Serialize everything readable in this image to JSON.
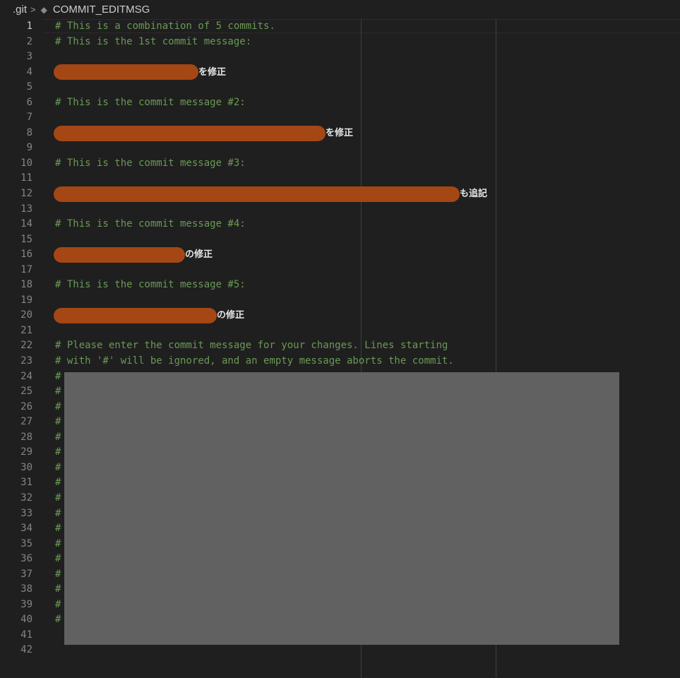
{
  "breadcrumb": {
    "folder": ".git",
    "file": "COMMIT_EDITMSG"
  },
  "active_line": 1,
  "line_numbers": [
    "1",
    "2",
    "3",
    "4",
    "5",
    "6",
    "7",
    "8",
    "9",
    "10",
    "11",
    "12",
    "13",
    "14",
    "15",
    "16",
    "17",
    "18",
    "19",
    "20",
    "21",
    "22",
    "23",
    "24",
    "25",
    "26",
    "27",
    "28",
    "29",
    "30",
    "31",
    "32",
    "33",
    "34",
    "35",
    "36",
    "37",
    "38",
    "39",
    "40",
    "41",
    "42"
  ],
  "lines": [
    "# This is a combination of 5 commits.",
    "# This is the 1st commit message:",
    "",
    "",
    "",
    "# This is the commit message #2:",
    "",
    "",
    "",
    "# This is the commit message #3:",
    "",
    "",
    "",
    "# This is the commit message #4:",
    "",
    "",
    "",
    "# This is the commit message #5:",
    "",
    "",
    "",
    "# Please enter the commit message for your changes. Lines starting",
    "# with '#' will be ignored, and an empty message aborts the commit.",
    "#",
    "#",
    "#",
    "#",
    "#",
    "#",
    "#",
    "#",
    "#",
    "#",
    "#",
    "#",
    "#",
    "#",
    "#",
    "#",
    "#",
    ""
  ],
  "messages": {
    "m1": "を修正",
    "m2": "を修正",
    "m3": "も追記",
    "m4": "の修正",
    "m5": "の修正"
  },
  "colors": {
    "background": "#1f1f1f",
    "comment": "#6a9955",
    "redaction_orange": "#a44715",
    "redaction_gray": "#616161"
  }
}
